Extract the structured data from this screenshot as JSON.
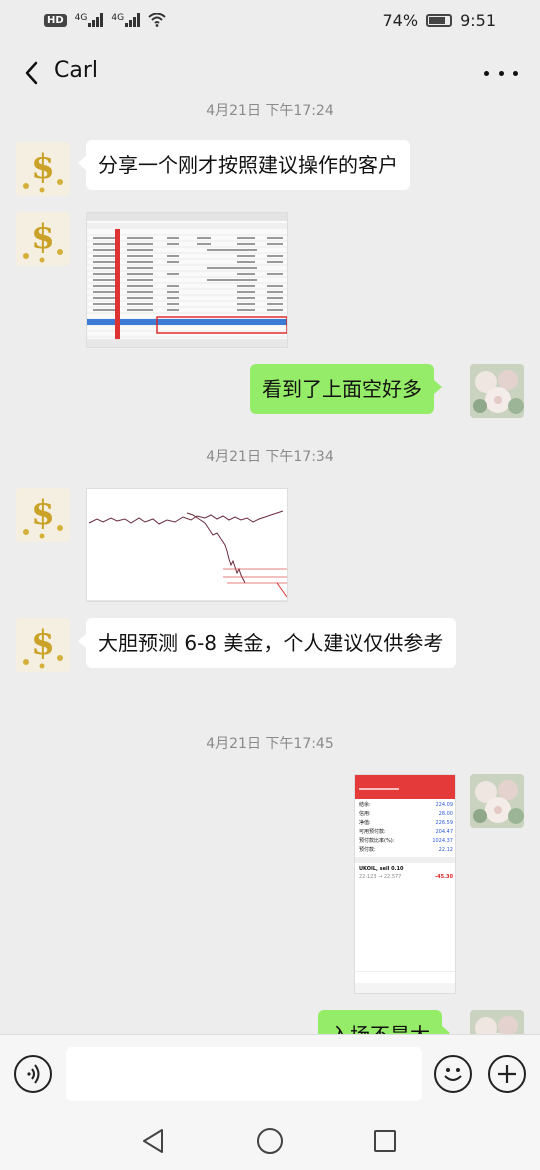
{
  "status_bar": {
    "hd": "HD",
    "signal1_label": "4G",
    "signal2_label": "4G",
    "battery_percent": "74%",
    "time": "9:51",
    "battery_level": 0.74
  },
  "header": {
    "title": "Carl"
  },
  "chat": {
    "timestamps": [
      "4月21日 下午17:24",
      "4月21日 下午17:34",
      "4月21日 下午17:45"
    ],
    "messages": [
      {
        "from": "contact",
        "type": "text",
        "text": "分享一个刚才按照建议操作的客户"
      },
      {
        "from": "contact",
        "type": "image",
        "content": "trade-history-screenshot"
      },
      {
        "from": "me",
        "type": "text",
        "text": "看到了上面空好多"
      },
      {
        "from": "contact",
        "type": "image",
        "content": "price-chart-screenshot"
      },
      {
        "from": "contact",
        "type": "text",
        "text": "大胆预测 6-8 美金，个人建议仅供参考"
      },
      {
        "from": "me",
        "type": "image",
        "content": "mobile-account-screenshot"
      },
      {
        "from": "me",
        "type": "text",
        "text": "入场不是太"
      }
    ]
  },
  "mobile_screenshot": {
    "rows": [
      {
        "label": "结余:",
        "value": "224.09"
      },
      {
        "label": "信用:",
        "value": "28.00"
      },
      {
        "label": "净值:",
        "value": "226.59"
      },
      {
        "label": "可用预付款:",
        "value": "204.47"
      },
      {
        "label": "预付款比率(%):",
        "value": "1024.37"
      },
      {
        "label": "预付款:",
        "value": "22.12"
      }
    ],
    "position_symbol": "UKOIL, sell 0.10",
    "position_prices": "22.123 → 22.577",
    "position_pl": "-45.30"
  },
  "input_bar": {
    "placeholder": ""
  },
  "colors": {
    "chat_background": "#ededed",
    "my_bubble": "#95ec69",
    "contact_bubble": "#ffffff"
  }
}
